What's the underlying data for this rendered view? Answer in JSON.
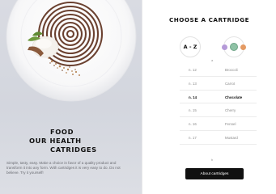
{
  "hero": {
    "headline": [
      "FOOD",
      "OUR HEALTH",
      "CATRIDGES"
    ],
    "description": "Simple, tasty, easy. Make a choice in favor of a quality product and transform it into any form. With cartridges it is very easy to do. Do not believe. Try it yourself!"
  },
  "selector": {
    "title": "CHOOSE A CARTRIDGE",
    "sort_label": "A - Z",
    "marker_top": "a",
    "marker_bottom": "b",
    "active_index": 2,
    "cartridges": [
      {
        "number": "n. 12",
        "name": "Broccoli"
      },
      {
        "number": "n. 13",
        "name": "Carrot"
      },
      {
        "number": "n. 14",
        "name": "Chocolate"
      },
      {
        "number": "n. 15",
        "name": "Cherry"
      },
      {
        "number": "n. 16",
        "name": "Fennel"
      },
      {
        "number": "n. 17",
        "name": "Mustard"
      }
    ],
    "button_label": "About cartridges"
  },
  "colors": {
    "accent": "#111111",
    "dot_purple": "#b59ad8",
    "dot_green": "#8fc2a6",
    "dot_orange": "#e49a63",
    "panel_bg": "#d9dbe2"
  }
}
